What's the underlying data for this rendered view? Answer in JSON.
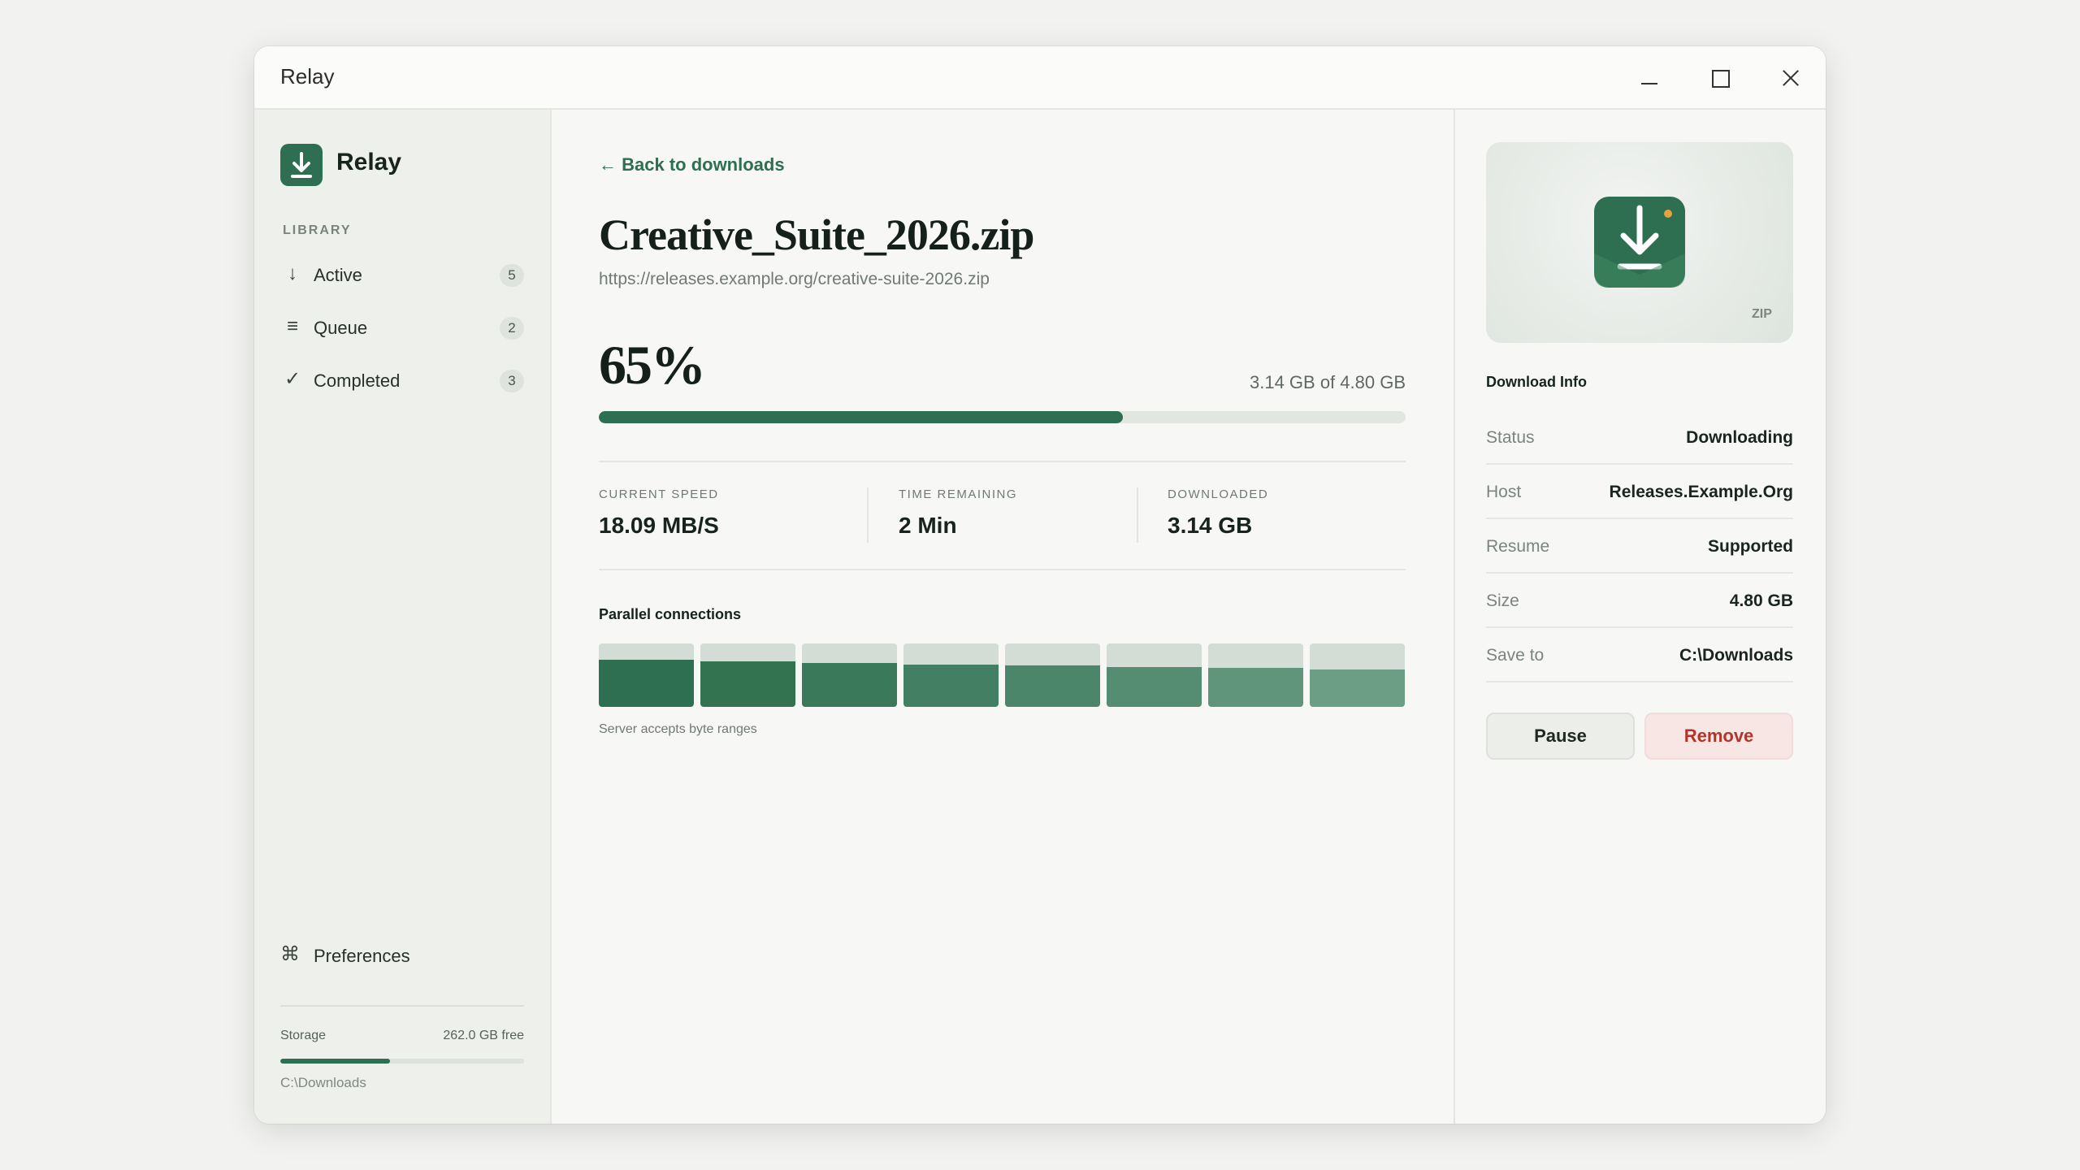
{
  "window": {
    "title": "Relay"
  },
  "app": {
    "name": "Relay",
    "logo_icon": "download-icon"
  },
  "sidebar": {
    "section_label": "LIBRARY",
    "items": [
      {
        "label": "Active",
        "count": "5",
        "icon": "arrow-down-icon",
        "glyph": "↓"
      },
      {
        "label": "Queue",
        "count": "2",
        "icon": "list-icon",
        "glyph": "≡"
      },
      {
        "label": "Completed",
        "count": "3",
        "icon": "check-icon",
        "glyph": "✓"
      }
    ],
    "preferences": {
      "label": "Preferences",
      "icon": "command-icon",
      "glyph": "⌘"
    },
    "storage": {
      "label": "Storage",
      "free": "262.0 GB free",
      "used_percent": 45,
      "path": "C:\\Downloads"
    }
  },
  "main": {
    "back_link": "← Back to downloads",
    "file_name": "Creative_Suite_2026.zip",
    "url": "https://releases.example.org/creative-suite-2026.zip",
    "percent": "65%",
    "progress_value": 65,
    "size_progress": "3.14 GB of 4.80 GB",
    "stats": [
      {
        "label": "CURRENT SPEED",
        "value": "18.09 MB/S"
      },
      {
        "label": "TIME REMAINING",
        "value": "2 Min"
      },
      {
        "label": "DOWNLOADED",
        "value": "3.14 GB"
      }
    ],
    "connections_title": "Parallel connections",
    "connections": [
      0.74,
      0.72,
      0.69,
      0.67,
      0.65,
      0.63,
      0.61,
      0.59
    ],
    "connection_colors": [
      "#2e6e51",
      "#33734f",
      "#3a7a5a",
      "#437f62",
      "#4c866a",
      "#558d72",
      "#60957b",
      "#6b9e85"
    ],
    "connections_note": "Server accepts byte ranges"
  },
  "details": {
    "preview_ext": "ZIP",
    "preview_icon": "download-icon",
    "title": "Download Info",
    "rows": [
      {
        "label": "Status",
        "value": "Downloading"
      },
      {
        "label": "Host",
        "value": "Releases.Example.Org"
      },
      {
        "label": "Resume",
        "value": "Supported"
      },
      {
        "label": "Size",
        "value": "4.80 GB"
      },
      {
        "label": "Save to",
        "value": "C:\\Downloads"
      }
    ],
    "pause_label": "Pause",
    "remove_label": "Remove"
  },
  "colors": {
    "accent": "#2e6e51",
    "danger": "#b0362c"
  }
}
